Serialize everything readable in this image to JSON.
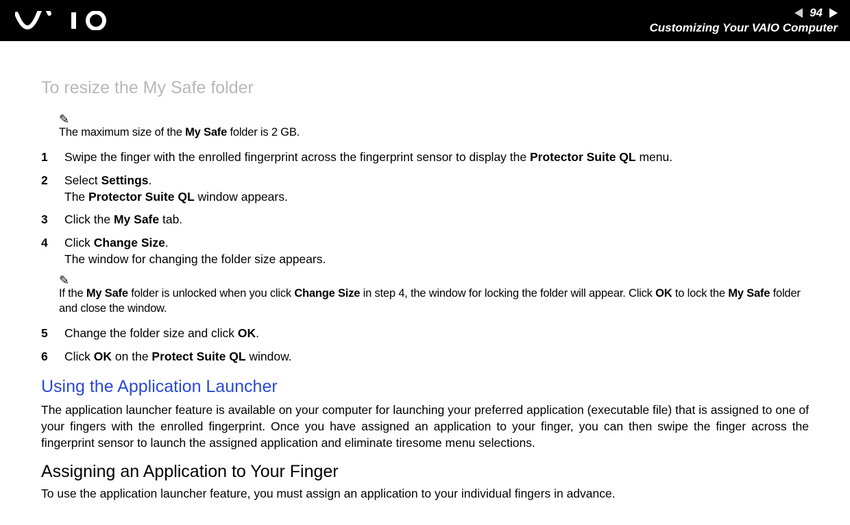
{
  "header": {
    "page_number": "94",
    "breadcrumb": "Customizing Your VAIO Computer"
  },
  "section1": {
    "title": "To resize the My Safe folder",
    "note1_pre": "The maximum size of the ",
    "note1_b1": "My Safe",
    "note1_post": " folder is 2 GB.",
    "step1_pre": "Swipe the finger with the enrolled fingerprint across the fingerprint sensor to display the ",
    "step1_b1": "Protector Suite QL",
    "step1_post": " menu.",
    "step2_l1_pre": "Select ",
    "step2_l1_b1": "Settings",
    "step2_l1_post": ".",
    "step2_l2_pre": "The ",
    "step2_l2_b1": "Protector Suite QL",
    "step2_l2_post": " window appears.",
    "step3_pre": "Click the ",
    "step3_b1": "My Safe",
    "step3_post": " tab.",
    "step4_l1_pre": "Click ",
    "step4_l1_b1": "Change Size",
    "step4_l1_post": ".",
    "step4_l2": "The window for changing the folder size appears.",
    "note2_p1": "If the ",
    "note2_b1": "My Safe",
    "note2_p2": " folder is unlocked when you click ",
    "note2_b2": "Change Size",
    "note2_p3": " in step 4, the window for locking the folder will appear. Click ",
    "note2_b3": "OK",
    "note2_p4": " to lock the ",
    "note2_b4": "My Safe",
    "note2_p5": " folder and close the window.",
    "step5_pre": "Change the folder size and click ",
    "step5_b1": "OK",
    "step5_post": ".",
    "step6_pre": "Click ",
    "step6_b1": "OK",
    "step6_mid": " on the ",
    "step6_b2": "Protect Suite QL",
    "step6_post": " window."
  },
  "section2": {
    "title": "Using the Application Launcher",
    "para": "The application launcher feature is available on your computer for launching your preferred application (executable file) that is assigned to one of your fingers with the enrolled fingerprint. Once you have assigned an application to your finger, you can then swipe the finger across the fingerprint sensor to launch the assigned application and eliminate tiresome menu selections."
  },
  "section3": {
    "title": "Assigning an Application to Your Finger",
    "para": "To use the application launcher feature, you must assign an application to your individual fingers in advance."
  },
  "nums": {
    "n1": "1",
    "n2": "2",
    "n3": "3",
    "n4": "4",
    "n5": "5",
    "n6": "6"
  },
  "pencil": "✎"
}
